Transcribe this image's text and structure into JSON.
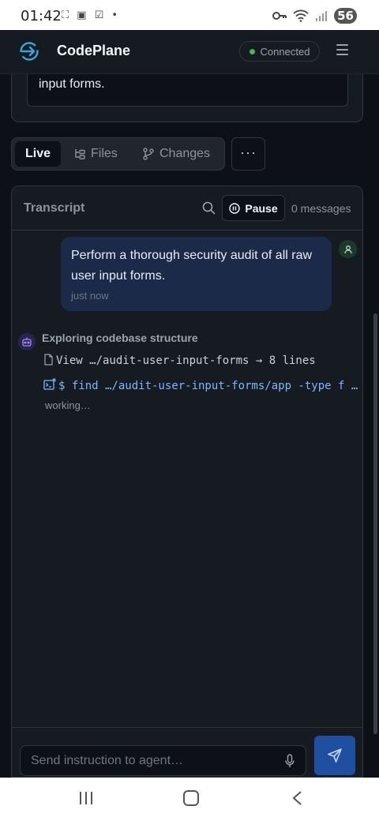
{
  "status_bar": {
    "time": "01:42",
    "left_icons": "⛶ ▣ ☑ •",
    "battery": "56"
  },
  "header": {
    "app_name": "CodePlane",
    "connection_status": "Connected",
    "connection_color": "#3fb950"
  },
  "previous_card": {
    "text": "input forms."
  },
  "tabs": [
    {
      "label": "Live",
      "icon": "live",
      "active": true
    },
    {
      "label": "Files",
      "icon": "file-tree-icon",
      "active": false
    },
    {
      "label": "Changes",
      "icon": "git-branch-icon",
      "active": false
    }
  ],
  "more_label": "···",
  "transcript": {
    "title": "Transcript",
    "pause_label": "Pause",
    "message_count": "0 messages",
    "user_message": {
      "text": "Perform a thorough security audit of all raw user input forms.",
      "time": "just now"
    },
    "agent": {
      "title": "Exploring codebase structure",
      "view_line": "View …/audit-user-input-forms → 8 lines",
      "command_line": "$ find …/audit-user-input-forms/app -type f …",
      "status": "working…"
    }
  },
  "composer": {
    "placeholder": "Send instruction to agent…"
  },
  "colors": {
    "accent": "#1f4fa0",
    "background": "#0d1117",
    "panel": "#161b22",
    "user_bubble": "#1c2a4a"
  }
}
